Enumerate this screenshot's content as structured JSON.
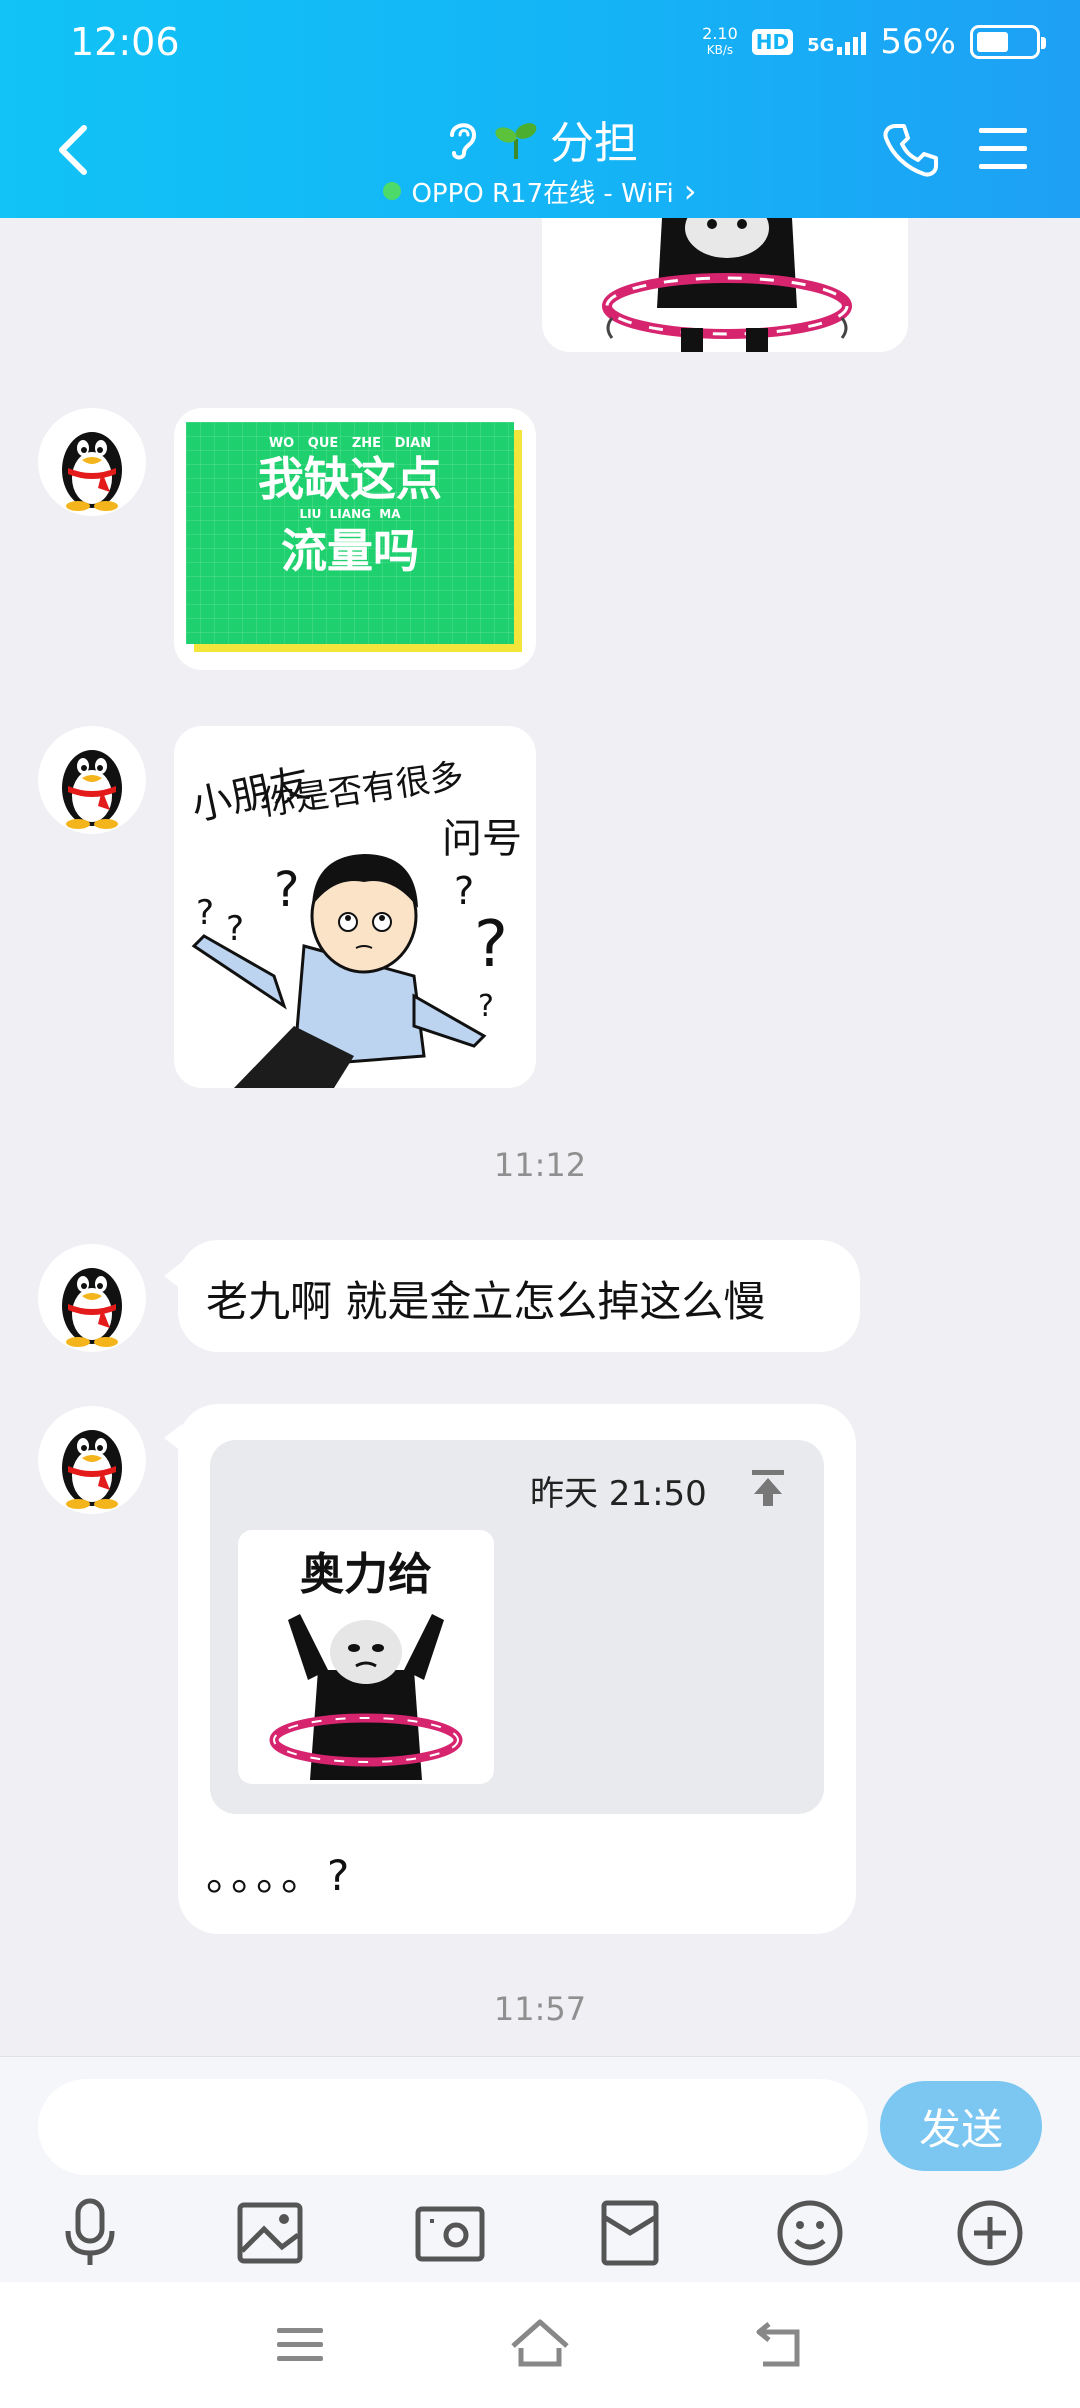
{
  "status_bar": {
    "time": "12:06",
    "net_speed_value": "2.10",
    "net_speed_unit": "KB/s",
    "hd": "HD",
    "network": "5G",
    "battery_percent": "56%",
    "battery_level": 0.56
  },
  "header": {
    "title": "分担",
    "title_icons": [
      "ear-icon",
      "sprout-icon"
    ],
    "subtitle": "OPPO R17在线 - WiFi",
    "subtitle_chevron": "›",
    "online_color": "#4cdb6a"
  },
  "messages": {
    "sticker_wo_que": {
      "pinyin_top": "WO   QUE   ZHE   DIAN",
      "line1": "我缺这点",
      "pinyin_bottom": "LIU  LIANG  MA",
      "line2": "流量吗"
    },
    "sticker_question": {
      "line1": "小朋友",
      "line2": "你是否有很多",
      "line3": "问号"
    },
    "time_1": "11:12",
    "text_1": "老九啊 就是金立怎么掉这么慢",
    "quote": {
      "time": "昨天 21:50",
      "sticker_caption": "奥力给"
    },
    "text_2": "。。。。?",
    "time_2": "11:57"
  },
  "input": {
    "value": "",
    "placeholder": "",
    "send_label": "发送"
  },
  "toolbar": [
    "microphone-icon",
    "image-icon",
    "camera-icon",
    "red-packet-icon",
    "emoji-icon",
    "plus-icon"
  ],
  "colors": {
    "header_start": "#11c3f6",
    "header_end": "#1ea0f5",
    "send_button": "#7cc6f2",
    "background": "#efeff4"
  }
}
